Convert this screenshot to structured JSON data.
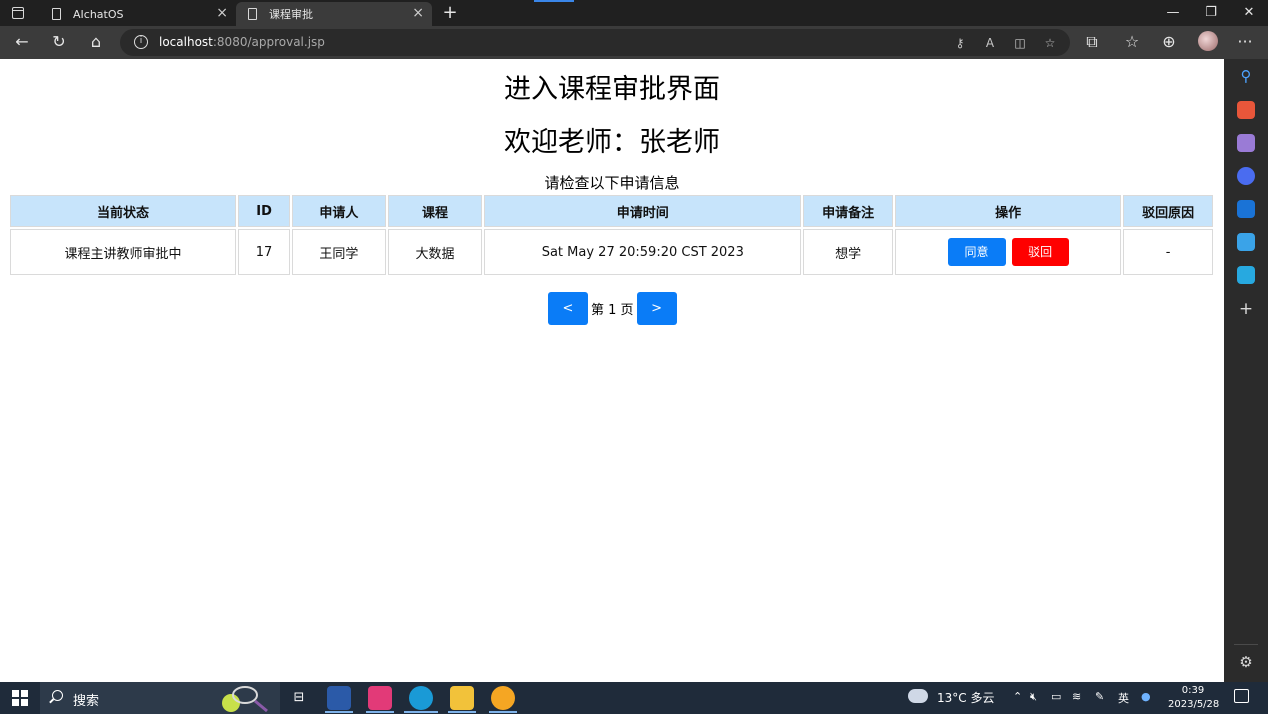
{
  "browser": {
    "tabs": [
      {
        "title": "AIchatOS"
      },
      {
        "title": "课程审批"
      }
    ],
    "address": {
      "host": "localhost",
      "rest": ":8080/approval.jsp"
    }
  },
  "page": {
    "heading": "进入课程审批界面",
    "welcome": "欢迎老师：张老师",
    "subtitle": "请检查以下申请信息",
    "table": {
      "headers": [
        "当前状态",
        "ID",
        "申请人",
        "课程",
        "申请时间",
        "申请备注",
        "操作",
        "驳回原因"
      ],
      "rows": [
        {
          "status": "课程主讲教师审批中",
          "id": "17",
          "applicant": "王同学",
          "course": "大数据",
          "time": "Sat May 27 20:59:20 CST 2023",
          "note": "想学",
          "approve_label": "同意",
          "reject_label": "驳回",
          "reject_reason": "-"
        }
      ]
    },
    "pager": {
      "prev": "<",
      "label": "第 1 页",
      "next": ">"
    }
  },
  "taskbar": {
    "search_placeholder": "搜索",
    "weather": "13°C  多云",
    "ime": "英",
    "time": "0:39",
    "date": "2023/5/28"
  },
  "colors": {
    "header_bg": "#c7e4fb",
    "approve": "#0a7cf7",
    "reject": "#ff0000"
  }
}
